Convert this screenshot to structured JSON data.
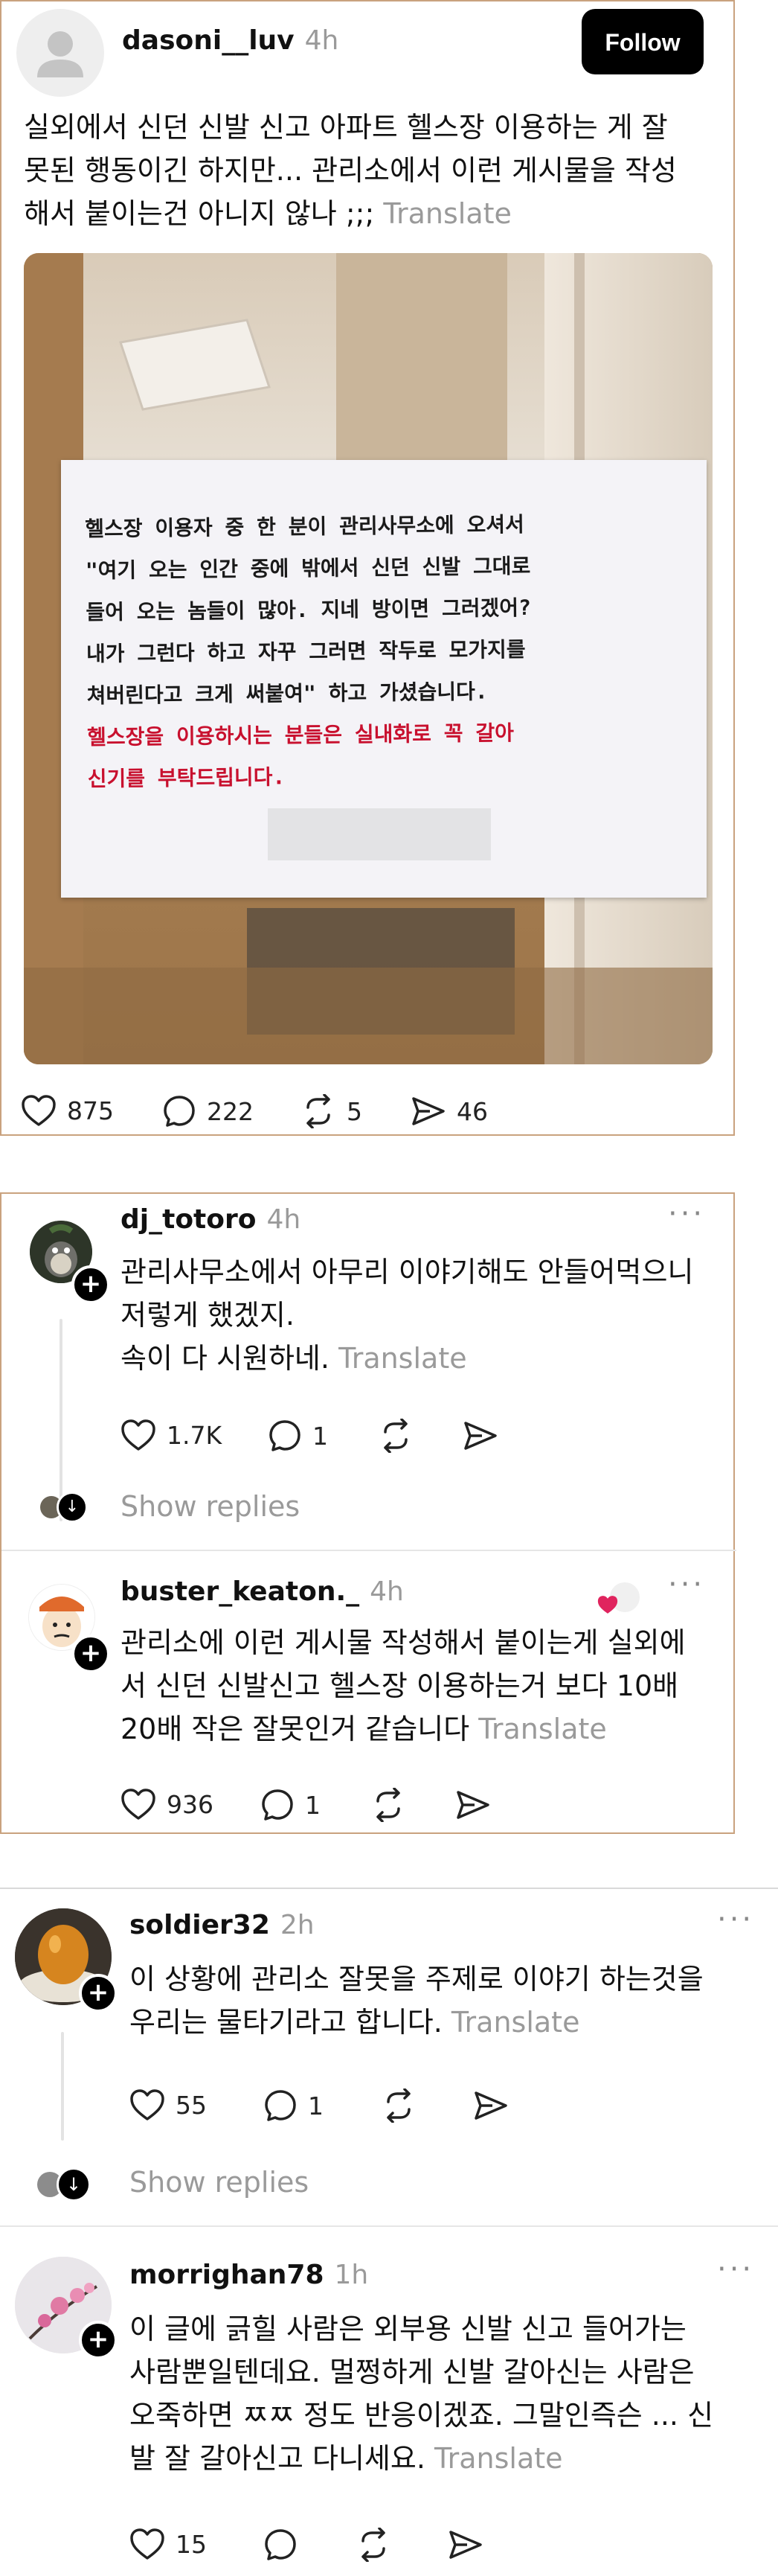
{
  "post": {
    "username": "dasoni__luv",
    "time": "4h",
    "follow_label": "Follow",
    "text_lines": [
      "실외에서 신던 신발 신고 아파트 헬스장 이용하는 게 잘",
      "못된 행동이긴 하지만... 관리소에서 이런 게시물을 작성",
      "해서 붙이는건 아니지 않나 ;;;"
    ],
    "translate": "Translate",
    "notice_lines": [
      "헬스장 이용자 중 한 분이 관리사무소에 오셔서",
      "\"여기 오는 인간 중에 밖에서 신던 신발 그대로",
      "들어 오는 놈들이 많아. 지네 방이면 그러겠어?",
      "내가 그런다 하고 자꾸 그러면 작두로 모가지를",
      "쳐버린다고 크게 써붙여\" 하고 가셨습니다."
    ],
    "notice_red_lines": [
      "헬스장을 이용하시는 분들은 실내화로 꼭 갈아",
      "신기를 부탁드립니다."
    ],
    "likes": "875",
    "comments": "222",
    "reposts": "5",
    "shares": "46"
  },
  "reply1": {
    "username": "dj_totoro",
    "time": "4h",
    "text_lines": [
      "관리사무소에서 아무리 이야기해도 안들어먹으니",
      "저렇게 했겠지.",
      "속이 다 시원하네."
    ],
    "translate": "Translate",
    "likes": "1.7K",
    "comments": "1",
    "show_replies": "Show replies"
  },
  "reply2": {
    "username": "buster_keaton._",
    "time": "4h",
    "text_lines": [
      "관리소에 이런 게시물 작성해서 붙이는게 실외에",
      "서 신던 신발신고 헬스장 이용하는거 보다 10배",
      "20배 작은 잘못인거 같습니다"
    ],
    "translate": "Translate",
    "likes": "936",
    "comments": "1"
  },
  "reply3": {
    "username": "soldier32",
    "time": "2h",
    "text_lines": [
      "이 상황에 관리소 잘못을 주제로 이야기 하는것을",
      "우리는 물타기라고 합니다."
    ],
    "translate": "Translate",
    "likes": "55",
    "comments": "1",
    "show_replies": "Show replies"
  },
  "reply4": {
    "username": "morrighan78",
    "time": "1h",
    "text_lines": [
      "이 글에 긁힐 사람은 외부용 신발 신고 들어가는",
      "사람뿐일텐데요. 멀쩡하게 신발 갈아신는 사람은",
      "오죽하면 ㅉㅉ 정도 반응이겠죠. 그말인즉슨 ... 신",
      "발 잘 갈아신고 다니세요."
    ],
    "translate": "Translate",
    "likes": "15"
  },
  "colors": {
    "card_border": "#c9a27e",
    "notice_red": "#c8102e",
    "muted": "#9a9a9a",
    "heart_badge": "#e0245e"
  },
  "icons": [
    "heart-icon",
    "comment-icon",
    "repost-icon",
    "share-icon",
    "more-icon",
    "plus-icon",
    "arrow-down-icon",
    "person-icon"
  ]
}
